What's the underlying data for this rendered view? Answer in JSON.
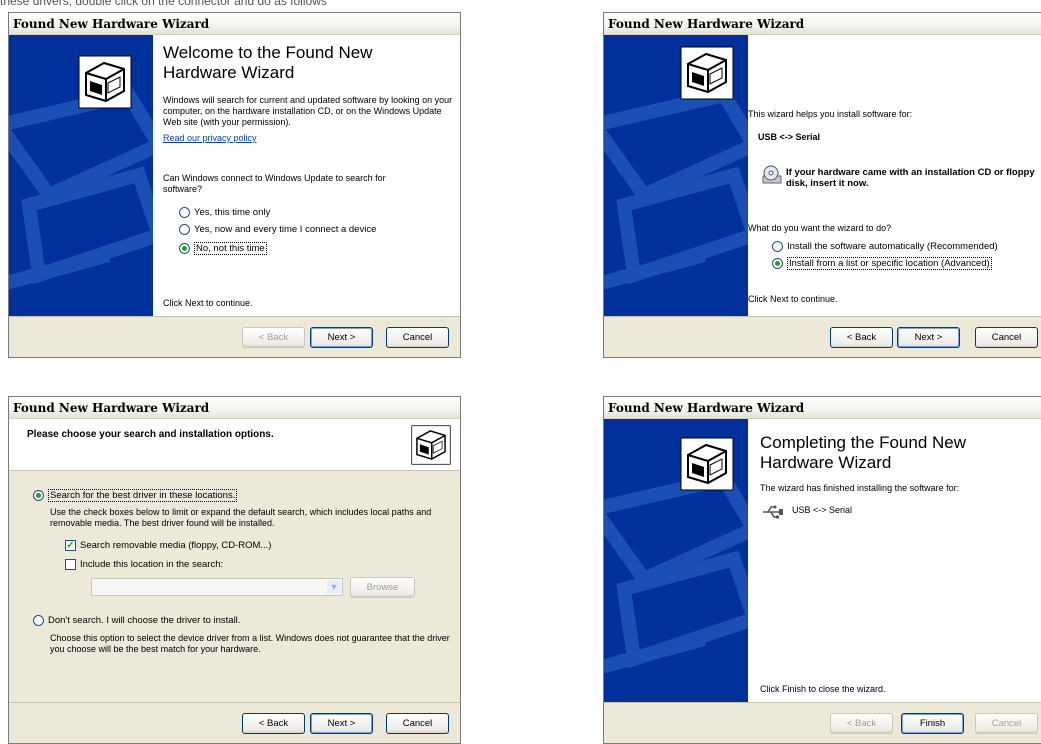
{
  "caption": "these drivers, double click on the connector and do as follows",
  "window_title": "Found New Hardware Wizard",
  "icon_names": [
    "hardware-box-icon",
    "cd-drive-icon",
    "usb-plug-icon"
  ],
  "colors": {
    "side_panel": "#00309c",
    "link": "#0a3fc4",
    "radio_dot": "#21a121"
  },
  "d1": {
    "title": "Welcome to the Found New Hardware Wizard",
    "intro": "Windows will search for current and updated software by looking on your computer, on the hardware installation CD, or on the Windows Update Web site (with your permission).",
    "privacy_link": "Read our privacy policy",
    "question": "Can Windows connect to Windows Update to search for software?",
    "opt1": "Yes, this time only",
    "opt2": "Yes, now and every time I connect a device",
    "opt3": "No, not this time",
    "footer": "Click Next to continue.",
    "back": "< Back",
    "next": "Next >",
    "cancel": "Cancel"
  },
  "d2": {
    "helps": "This wizard helps you install software for:",
    "device": "USB <-> Serial",
    "cd_notice": "If your hardware came with an installation CD or floppy disk, insert it now.",
    "question": "What do you want the wizard to do?",
    "opt1": "Install the software automatically (Recommended)",
    "opt2": "Install from a list or specific location (Advanced)",
    "footer": "Click Next to continue.",
    "back": "< Back",
    "next": "Next >",
    "cancel": "Cancel"
  },
  "d3": {
    "header": "Please choose your search and installation options.",
    "opt_search": "Search for the best driver in these locations.",
    "search_desc": "Use the check boxes below to limit or expand the default search, which includes local paths and removable media. The best driver found will be installed.",
    "chk1": "Search removable media (floppy, CD-ROM...)",
    "chk2": "Include this location in the search:",
    "combo_value": "",
    "browse": "Browse",
    "opt_dont": "Don't search. I will choose the driver to install.",
    "dont_desc": "Choose this option to select the device driver from a list. Windows does not guarantee that the driver you choose will be the best match for your hardware.",
    "back": "< Back",
    "next": "Next >",
    "cancel": "Cancel"
  },
  "d4": {
    "title": "Completing the Found New Hardware Wizard",
    "finished": "The wizard has finished installing the software for:",
    "device": "USB <-> Serial",
    "footer": "Click Finish to close the wizard.",
    "back": "< Back",
    "finish": "Finish",
    "cancel": "Cancel"
  }
}
